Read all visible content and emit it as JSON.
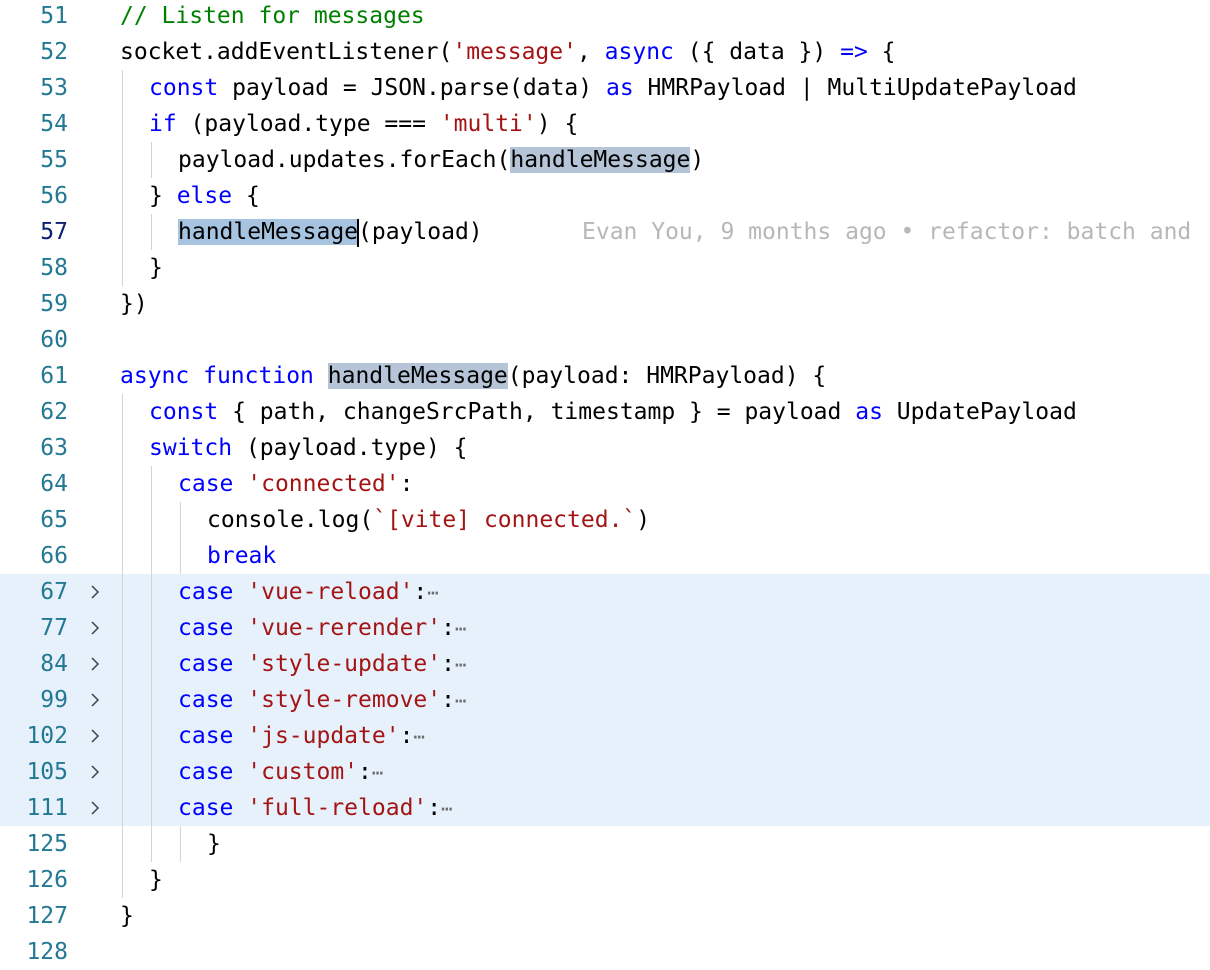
{
  "editor": {
    "lines": [
      {
        "num": "51",
        "indent": 0,
        "tokens": [
          [
            "comment",
            "// Listen for messages"
          ]
        ]
      },
      {
        "num": "52",
        "indent": 0,
        "tokens": [
          [
            "plain",
            "socket.addEventListener("
          ],
          [
            "string",
            "'message'"
          ],
          [
            "plain",
            ", "
          ],
          [
            "keyword",
            "async"
          ],
          [
            "plain",
            " ({ data }) "
          ],
          [
            "keyword",
            "=>"
          ],
          [
            "plain",
            " {"
          ]
        ]
      },
      {
        "num": "53",
        "indent": 1,
        "tokens": [
          [
            "keyword",
            "const"
          ],
          [
            "plain",
            " payload = JSON.parse(data) "
          ],
          [
            "keyword",
            "as"
          ],
          [
            "plain",
            " HMRPayload | MultiUpdatePayload"
          ]
        ]
      },
      {
        "num": "54",
        "indent": 1,
        "tokens": [
          [
            "keyword",
            "if"
          ],
          [
            "plain",
            " (payload.type === "
          ],
          [
            "string",
            "'multi'"
          ],
          [
            "plain",
            ") {"
          ]
        ]
      },
      {
        "num": "55",
        "indent": 2,
        "tokens": [
          [
            "plain",
            "payload.updates.forEach("
          ],
          [
            "hl",
            "handleMessage"
          ],
          [
            "plain",
            ")"
          ]
        ]
      },
      {
        "num": "56",
        "indent": 1,
        "tokens": [
          [
            "plain",
            "} "
          ],
          [
            "keyword",
            "else"
          ],
          [
            "plain",
            " {"
          ]
        ]
      },
      {
        "num": "57",
        "indent": 2,
        "active": true,
        "tokens": [
          [
            "hlsel",
            "handleMessage"
          ],
          [
            "cursor",
            ""
          ],
          [
            "plain",
            "(payload)"
          ]
        ],
        "blame": "Evan You, 9 months ago • refactor: batch and"
      },
      {
        "num": "58",
        "indent": 1,
        "tokens": [
          [
            "plain",
            "}"
          ]
        ]
      },
      {
        "num": "59",
        "indent": 0,
        "tokens": [
          [
            "plain",
            "})"
          ]
        ]
      },
      {
        "num": "60",
        "indent": 0,
        "tokens": []
      },
      {
        "num": "61",
        "indent": 0,
        "tokens": [
          [
            "keyword",
            "async"
          ],
          [
            "plain",
            " "
          ],
          [
            "keyword",
            "function"
          ],
          [
            "plain",
            " "
          ],
          [
            "hl",
            "handleMessage"
          ],
          [
            "plain",
            "(payload: HMRPayload) {"
          ]
        ]
      },
      {
        "num": "62",
        "indent": 1,
        "tokens": [
          [
            "keyword",
            "const"
          ],
          [
            "plain",
            " { path, changeSrcPath, timestamp } = payload "
          ],
          [
            "keyword",
            "as"
          ],
          [
            "plain",
            " UpdatePayload"
          ]
        ]
      },
      {
        "num": "63",
        "indent": 1,
        "tokens": [
          [
            "keyword",
            "switch"
          ],
          [
            "plain",
            " (payload.type) {"
          ]
        ]
      },
      {
        "num": "64",
        "indent": 2,
        "tokens": [
          [
            "keyword",
            "case"
          ],
          [
            "plain",
            " "
          ],
          [
            "string",
            "'connected'"
          ],
          [
            "plain",
            ":"
          ]
        ]
      },
      {
        "num": "65",
        "indent": 3,
        "tokens": [
          [
            "plain",
            "console.log("
          ],
          [
            "string",
            "`[vite] connected.`"
          ],
          [
            "plain",
            ")"
          ]
        ]
      },
      {
        "num": "66",
        "indent": 3,
        "tokens": [
          [
            "keyword",
            "break"
          ]
        ]
      },
      {
        "num": "67",
        "indent": 2,
        "folded": true,
        "tokens": [
          [
            "keyword",
            "case"
          ],
          [
            "plain",
            " "
          ],
          [
            "string",
            "'vue-reload'"
          ],
          [
            "plain",
            ":"
          ],
          [
            "ellipsis",
            "⋯"
          ]
        ]
      },
      {
        "num": "77",
        "indent": 2,
        "folded": true,
        "tokens": [
          [
            "keyword",
            "case"
          ],
          [
            "plain",
            " "
          ],
          [
            "string",
            "'vue-rerender'"
          ],
          [
            "plain",
            ":"
          ],
          [
            "ellipsis",
            "⋯"
          ]
        ]
      },
      {
        "num": "84",
        "indent": 2,
        "folded": true,
        "tokens": [
          [
            "keyword",
            "case"
          ],
          [
            "plain",
            " "
          ],
          [
            "string",
            "'style-update'"
          ],
          [
            "plain",
            ":"
          ],
          [
            "ellipsis",
            "⋯"
          ]
        ]
      },
      {
        "num": "99",
        "indent": 2,
        "folded": true,
        "tokens": [
          [
            "keyword",
            "case"
          ],
          [
            "plain",
            " "
          ],
          [
            "string",
            "'style-remove'"
          ],
          [
            "plain",
            ":"
          ],
          [
            "ellipsis",
            "⋯"
          ]
        ]
      },
      {
        "num": "102",
        "indent": 2,
        "folded": true,
        "tokens": [
          [
            "keyword",
            "case"
          ],
          [
            "plain",
            " "
          ],
          [
            "string",
            "'js-update'"
          ],
          [
            "plain",
            ":"
          ],
          [
            "ellipsis",
            "⋯"
          ]
        ]
      },
      {
        "num": "105",
        "indent": 2,
        "folded": true,
        "tokens": [
          [
            "keyword",
            "case"
          ],
          [
            "plain",
            " "
          ],
          [
            "string",
            "'custom'"
          ],
          [
            "plain",
            ":"
          ],
          [
            "ellipsis",
            "⋯"
          ]
        ]
      },
      {
        "num": "111",
        "indent": 2,
        "folded": true,
        "tokens": [
          [
            "keyword",
            "case"
          ],
          [
            "plain",
            " "
          ],
          [
            "string",
            "'full-reload'"
          ],
          [
            "plain",
            ":"
          ],
          [
            "ellipsis",
            "⋯"
          ]
        ]
      },
      {
        "num": "125",
        "indent": 3,
        "tokens": [
          [
            "plain",
            "}"
          ]
        ]
      },
      {
        "num": "126",
        "indent": 1,
        "tokens": [
          [
            "plain",
            "}"
          ]
        ]
      },
      {
        "num": "127",
        "indent": 0,
        "tokens": [
          [
            "plain",
            "}"
          ]
        ]
      },
      {
        "num": "128",
        "indent": 0,
        "tokens": []
      }
    ],
    "colors": {
      "line_number": "#237893",
      "active_line_number": "#0b216f",
      "keyword": "#0000ff",
      "string": "#a31515",
      "comment": "#008000",
      "folded_background": "#e6f1fb",
      "blame": "#b7b7b7"
    },
    "fold_icon": "chevron-right-icon"
  }
}
